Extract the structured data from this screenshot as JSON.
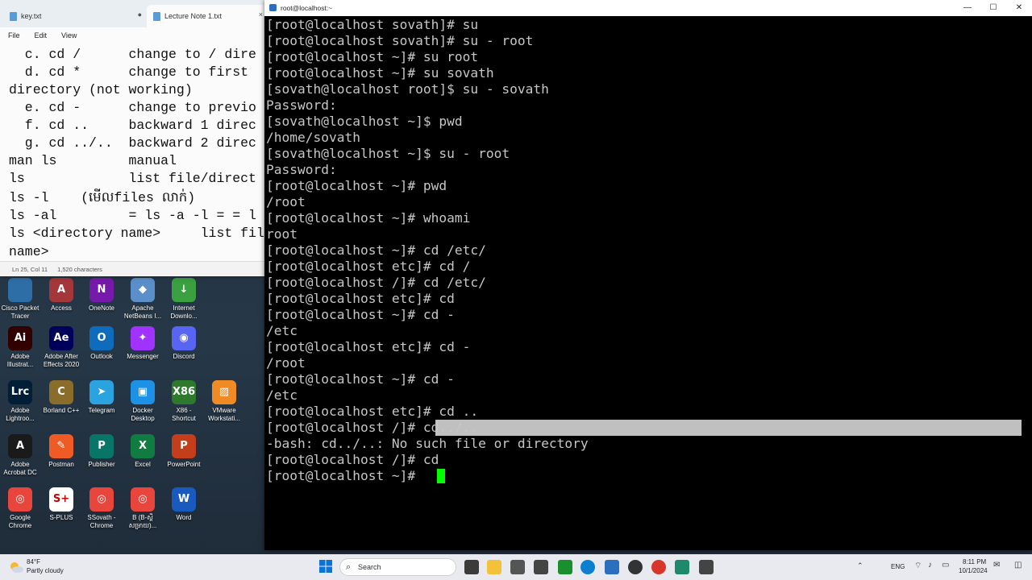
{
  "desktop": {
    "icons": [
      {
        "label": "Cisco Packet Tracer",
        "glyph": "",
        "color": "#2e6ea6"
      },
      {
        "label": "Access",
        "glyph": "A",
        "color": "#a4373a"
      },
      {
        "label": "OneNote",
        "glyph": "N",
        "color": "#7719aa"
      },
      {
        "label": "Apache NetBeans I...",
        "glyph": "◆",
        "color": "#5b8fc9"
      },
      {
        "label": "Internet Downlo...",
        "glyph": "↓",
        "color": "#3aa040"
      },
      {
        "label": "Adobe Illustrat...",
        "glyph": "Ai",
        "color": "#330000"
      },
      {
        "label": "Adobe After Effects 2020",
        "glyph": "Ae",
        "color": "#00005b"
      },
      {
        "label": "Outlook",
        "glyph": "O",
        "color": "#0f6cbd"
      },
      {
        "label": "Messenger",
        "glyph": "✦",
        "color": "#a033ff"
      },
      {
        "label": "Discord",
        "glyph": "◉",
        "color": "#5865f2"
      },
      {
        "label": "Adobe Lightroo...",
        "glyph": "Lrc",
        "color": "#001e36"
      },
      {
        "label": "Borland C++",
        "glyph": "C",
        "color": "#8a6d2a"
      },
      {
        "label": "Telegram",
        "glyph": "➤",
        "color": "#2aa3e0"
      },
      {
        "label": "Docker Desktop",
        "glyph": "▣",
        "color": "#1d91e6"
      },
      {
        "label": "X86 - Shortcut",
        "glyph": "X86",
        "color": "#2d7a2d"
      },
      {
        "label": "VMware Workstati...",
        "glyph": "▨",
        "color": "#f08a24"
      },
      {
        "label": "Adobe Acrobat DC",
        "glyph": "A",
        "color": "#1a1a1a"
      },
      {
        "label": "Postman",
        "glyph": "✎",
        "color": "#ef5b25"
      },
      {
        "label": "Publisher",
        "glyph": "P",
        "color": "#077568"
      },
      {
        "label": "Excel",
        "glyph": "X",
        "color": "#107c41"
      },
      {
        "label": "PowerPoint",
        "glyph": "P",
        "color": "#c43e1c"
      },
      {
        "label": "Google Chrome",
        "glyph": "◎",
        "color": "#e8453c"
      },
      {
        "label": "S-PLUS",
        "glyph": "S+",
        "color": "#ffffff"
      },
      {
        "label": "SSovath - Chrome",
        "glyph": "◎",
        "color": "#e8453c"
      },
      {
        "label": "B (B-ស្ដី សម្រាយ)...",
        "glyph": "◎",
        "color": "#e8453c"
      },
      {
        "label": "Word",
        "glyph": "W",
        "color": "#185abd"
      }
    ]
  },
  "notepad": {
    "tabs": [
      {
        "label": "key.txt",
        "close": "●"
      },
      {
        "label": "Lecture Note 1.txt",
        "close": "×"
      }
    ],
    "menu": [
      "File",
      "Edit",
      "View"
    ],
    "lines": [
      "  c. cd /      change to / dire",
      "  d. cd *      change to first",
      "directory (not working)",
      "  e. cd -      change to previo",
      "  f. cd ..     backward 1 direc",
      "  g. cd ../..  backward 2 direc",
      "man ls         manual",
      "ls             list file/direct",
      "ls -l    (មើលfiles លាក់)",
      "ls -al         = ls -a -l = = l",
      "ls <directory name>     list fil",
      "name>"
    ],
    "status": {
      "position": "Ln 25, Col 11",
      "chars": "1,520 characters"
    }
  },
  "terminal": {
    "title": "root@localhost:~",
    "controls": {
      "minimize": "—",
      "maximize": "☐",
      "close": "✕"
    },
    "lines": [
      "[root@localhost sovath]# su",
      "[root@localhost sovath]# su - root",
      "[root@localhost ~]# su root",
      "[root@localhost ~]# su sovath",
      "[sovath@localhost root]$ su - sovath",
      "Password:",
      "[sovath@localhost ~]$ pwd",
      "/home/sovath",
      "[sovath@localhost ~]$ su - root",
      "Password:",
      "[root@localhost ~]# pwd",
      "/root",
      "[root@localhost ~]# whoami",
      "root",
      "[root@localhost ~]# cd /etc/",
      "[root@localhost etc]# cd /",
      "[root@localhost /]# cd /etc/",
      "[root@localhost etc]# cd",
      "[root@localhost ~]# cd -",
      "/etc",
      "[root@localhost etc]# cd -",
      "/root",
      "[root@localhost ~]# cd -",
      "/etc",
      "[root@localhost etc]# cd ..",
      "[root@localhost /]# cd../..",
      "-bash: cd../..: No such file or directory",
      "[root@localhost /]# cd",
      "[root@localhost ~]# "
    ]
  },
  "taskbar": {
    "weather": {
      "temp": "84°F",
      "desc": "Partly cloudy"
    },
    "search_placeholder": "Search",
    "lang": "ENG",
    "time": "8:11 PM",
    "date": "10/1/2024"
  }
}
